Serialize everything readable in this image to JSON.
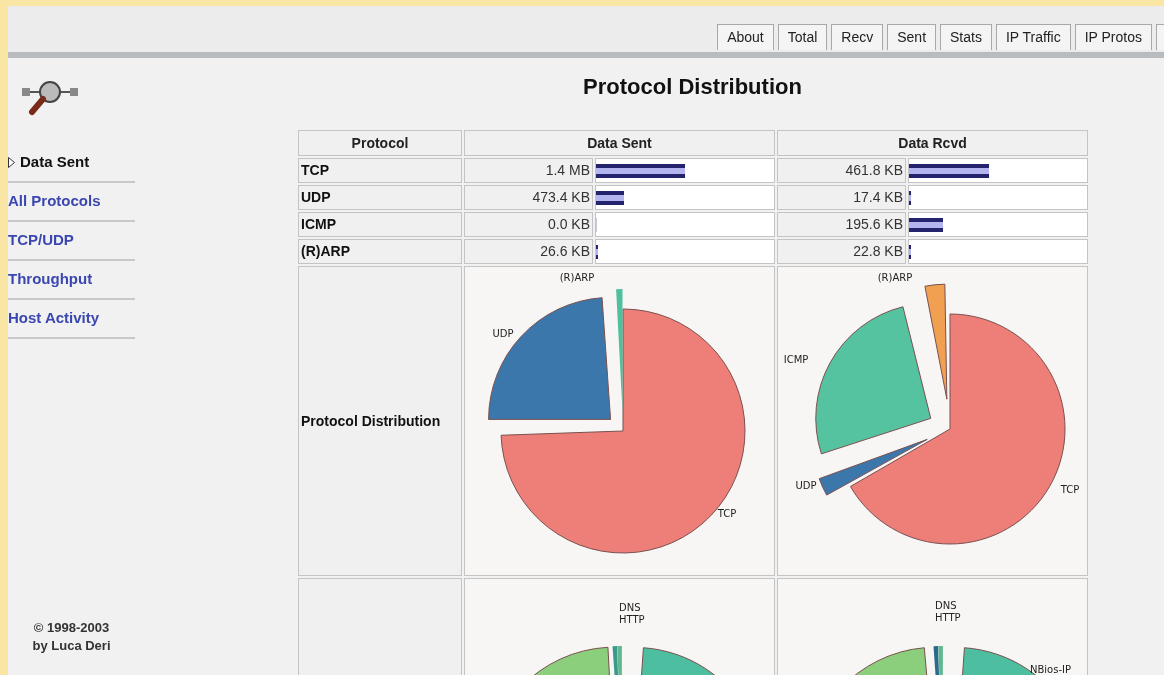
{
  "tabs": [
    {
      "label": "About",
      "selected": false
    },
    {
      "label": "Total",
      "selected": false
    },
    {
      "label": "Recv",
      "selected": false
    },
    {
      "label": "Sent",
      "selected": false
    },
    {
      "label": "Stats",
      "selected": false
    },
    {
      "label": "IP Traffic",
      "selected": false
    },
    {
      "label": "IP Protos",
      "selected": false
    }
  ],
  "sidebar": {
    "items": [
      {
        "label": "Data Sent",
        "selected": true
      },
      {
        "label": "All Protocols",
        "selected": false
      },
      {
        "label": "TCP/UDP",
        "selected": false
      },
      {
        "label": "Throughput",
        "selected": false
      },
      {
        "label": "Host Activity",
        "selected": false
      }
    ],
    "copyright": [
      "© 1998-2003",
      "by Luca Deri"
    ]
  },
  "title": "Protocol Distribution",
  "table": {
    "columns": [
      "Protocol",
      "Data Sent",
      "Data Rcvd"
    ],
    "rows": [
      {
        "protocol": "TCP",
        "sent": {
          "value": "1.4 MB",
          "level": 0.5
        },
        "rcvd": {
          "value": "461.8 KB",
          "level": 0.45
        }
      },
      {
        "protocol": "UDP",
        "sent": {
          "value": "473.4 KB",
          "level": 0.16
        },
        "rcvd": {
          "value": "17.4 KB",
          "level": 0.01
        }
      },
      {
        "protocol": "ICMP",
        "sent": {
          "value": "0.0 KB",
          "level": 0
        },
        "rcvd": {
          "value": "195.6 KB",
          "level": 0.19
        }
      },
      {
        "protocol": "(R)ARP",
        "sent": {
          "value": "26.6 KB",
          "level": 0.01
        },
        "rcvd": {
          "value": "22.8 KB",
          "level": 0.01
        }
      }
    ],
    "chart_rows": [
      {
        "label": "Protocol Distribution",
        "pies": [
          {
            "slices": [
              {
                "label": "TCP",
                "color": "#ee7f78"
              },
              {
                "label": "UDP",
                "color": "#3b77ab"
              },
              {
                "label": "(R)ARP",
                "color": "#4fbf9c"
              }
            ]
          },
          {
            "slices": [
              {
                "label": "TCP",
                "color": "#ee7f78"
              },
              {
                "label": "UDP",
                "color": "#3b77ab"
              },
              {
                "label": "ICMP",
                "color": "#55c2a0"
              },
              {
                "label": "(R)ARP",
                "color": "#f0a050"
              }
            ]
          }
        ]
      },
      {
        "pies": [
          {
            "slices": [
              {
                "label": "DNS",
                "color": "#3a9a8a"
              },
              {
                "label": "HTTP",
                "color": "#60b890"
              },
              {
                "color": "#4dbfa0"
              },
              {
                "color": "#8bcf7c"
              }
            ]
          },
          {
            "slices": [
              {
                "label": "DNS",
                "color": "#2a6a8a"
              },
              {
                "label": "HTTP",
                "color": "#60b890"
              },
              {
                "label": "NBios-IP",
                "color": "#4dbfa0"
              },
              {
                "color": "#8bcf7c"
              }
            ]
          }
        ]
      }
    ]
  }
}
